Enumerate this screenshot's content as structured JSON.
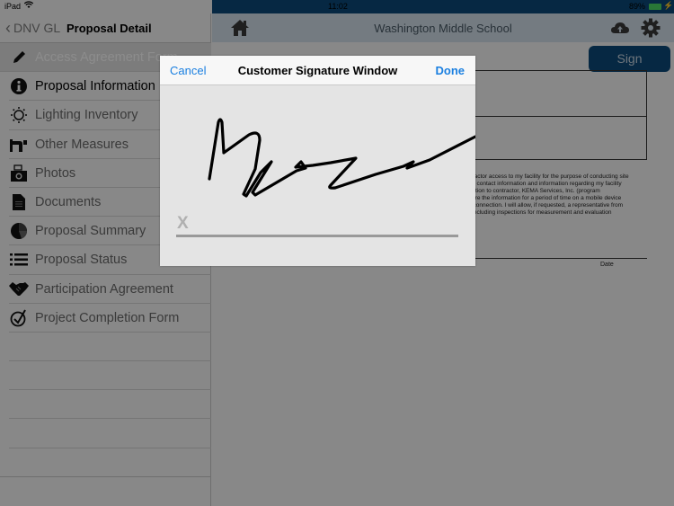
{
  "status_bar": {
    "carrier": "iPad",
    "wifi_icon": "wifi-icon",
    "time": "11:02",
    "battery_percent": "89%",
    "battery_level": 0.89,
    "charging_icon": "charging-icon"
  },
  "sidebar": {
    "back_label": "DNV GL",
    "title": "Proposal Detail",
    "items": [
      {
        "label": "Access Agreement Form",
        "icon": "pencil-icon",
        "state": "selected"
      },
      {
        "label": "Proposal Information",
        "icon": "info-icon",
        "state": "active"
      },
      {
        "label": "Lighting Inventory",
        "icon": "sun-icon",
        "state": "normal"
      },
      {
        "label": "Other Measures",
        "icon": "pipe-icon",
        "state": "normal"
      },
      {
        "label": "Photos",
        "icon": "camera-icon",
        "state": "normal"
      },
      {
        "label": "Documents",
        "icon": "document-icon",
        "state": "normal"
      },
      {
        "label": "Proposal Summary",
        "icon": "pie-chart-icon",
        "state": "normal"
      },
      {
        "label": "Proposal Status",
        "icon": "list-icon",
        "state": "normal"
      },
      {
        "label": "Participation Agreement",
        "icon": "handshake-icon",
        "state": "normal"
      },
      {
        "label": "Project Completion Form",
        "icon": "check-circle-icon",
        "state": "normal"
      }
    ]
  },
  "main": {
    "header_title": "Washington Middle School",
    "sign_label": "Sign",
    "document_text_lines": [
      "ntractor access to my facility for the purpose of conducting site",
      "my contact information and information regarding my facility",
      "mation to contractor, KEMA Services, Inc. (program",
      "store the information for a period of time on a mobile device",
      "ic connection. I will allow, if requested, a representative from",
      "t, including inspections for measurement and evaluation"
    ],
    "date_label": "Date"
  },
  "modal": {
    "title": "Customer Signature Window",
    "cancel_label": "Cancel",
    "done_label": "Done",
    "x_marker": "X"
  },
  "colors": {
    "brand_blue": "#0b4a7a",
    "ios_blue": "#1a7fe0",
    "battery_green": "#4cd964"
  }
}
